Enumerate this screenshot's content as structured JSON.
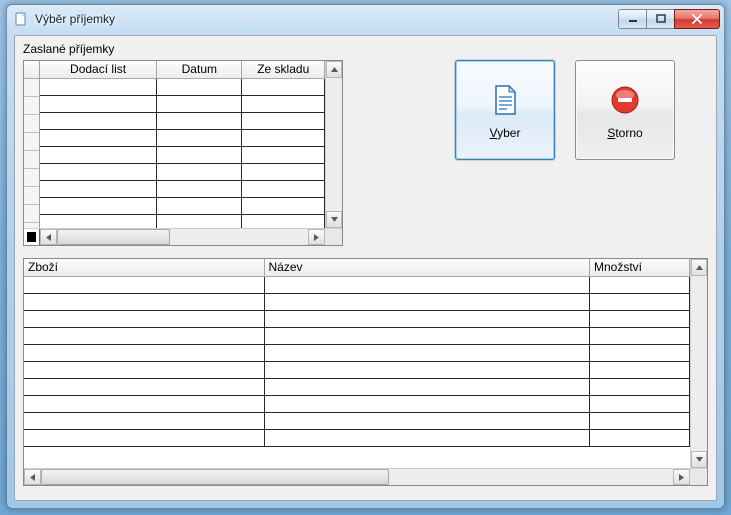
{
  "window": {
    "title": "Výběr příjemky"
  },
  "sections": {
    "header_label": "Zaslané příjemky"
  },
  "table_top": {
    "columns": [
      "Dodací list",
      "Datum",
      "Ze skladu"
    ],
    "row_count": 9
  },
  "table_bottom": {
    "columns": [
      "Zboží",
      "Název",
      "Množství"
    ],
    "row_count": 10
  },
  "buttons": {
    "select": {
      "label": "Vyber",
      "hotkey_index": 0
    },
    "cancel": {
      "label": "Storno",
      "hotkey_index": 0
    }
  }
}
